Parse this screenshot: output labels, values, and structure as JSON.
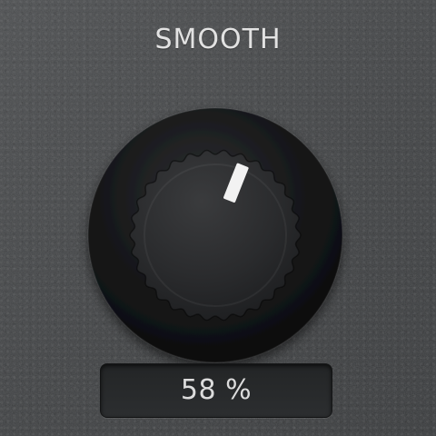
{
  "control": {
    "title": "SMOOTH",
    "value_display": "58 %",
    "value_percent": 58,
    "type": "rotary-knob"
  },
  "colors": {
    "panel": "#3f4143",
    "knob_ring": "#111214",
    "knob_cap": "#2a2b2d",
    "indicator": "#f2f2f2",
    "text": "#e2e2e2",
    "display_bg": "#27292b"
  }
}
